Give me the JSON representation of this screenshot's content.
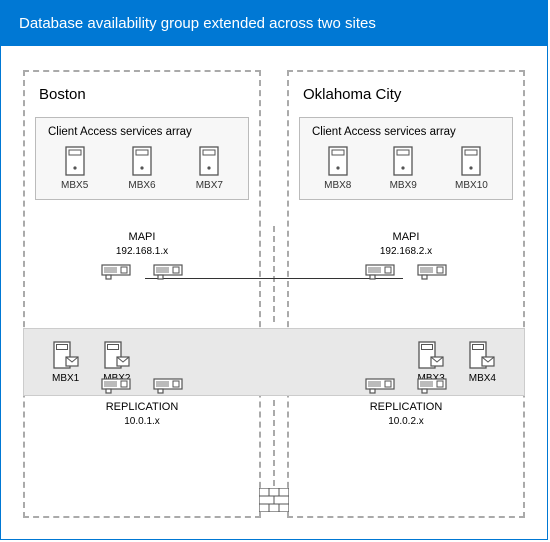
{
  "title": "Database availability group extended across two sites",
  "sites": {
    "left": {
      "name": "Boston",
      "cas_label": "Client Access services array",
      "cas_servers": [
        "MBX5",
        "MBX6",
        "MBX7"
      ],
      "mapi": {
        "name": "MAPI",
        "subnet": "192.168.1.x"
      },
      "repl": {
        "name": "REPLICATION",
        "subnet": "10.0.1.x"
      },
      "mbx_servers": [
        "MBX1",
        "MBX2"
      ]
    },
    "right": {
      "name": "Oklahoma City",
      "cas_label": "Client Access services array",
      "cas_servers": [
        "MBX8",
        "MBX9",
        "MBX10"
      ],
      "mapi": {
        "name": "MAPI",
        "subnet": "192.168.2.x"
      },
      "repl": {
        "name": "REPLICATION",
        "subnet": "10.0.2.x"
      },
      "mbx_servers": [
        "MBX3",
        "MBX4"
      ]
    }
  },
  "icons": {
    "server": "server-icon",
    "mailbox_server": "mailbox-server-icon",
    "nic": "nic-icon",
    "firewall": "firewall-icon"
  }
}
